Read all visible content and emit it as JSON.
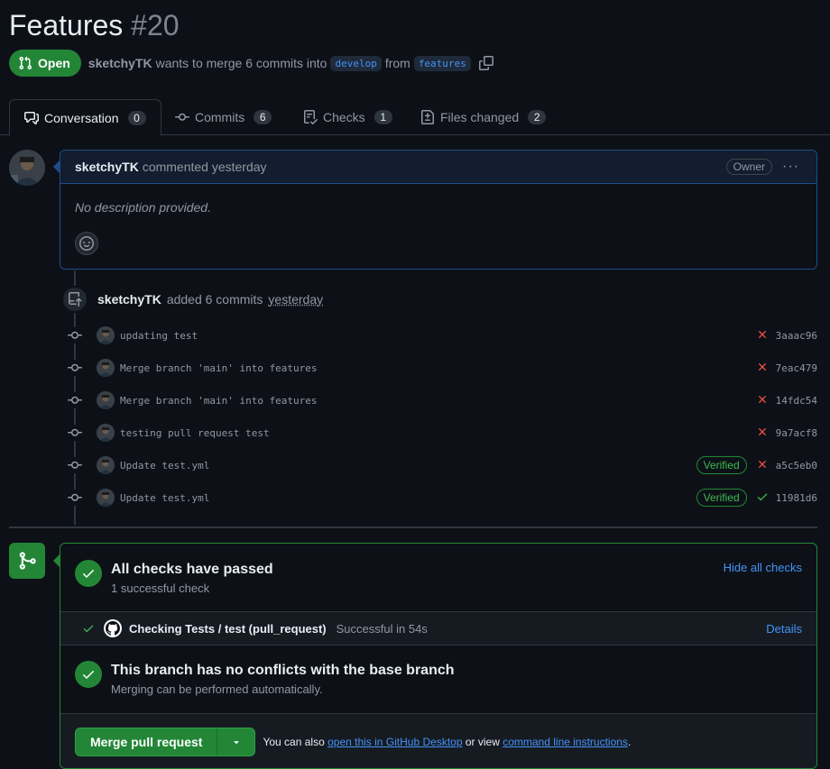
{
  "pr": {
    "title": "Features",
    "number": "#20",
    "state": "Open",
    "author": "sketchyTK",
    "merge_text": "wants to merge 6 commits into",
    "base_branch": "develop",
    "from_text": "from",
    "head_branch": "features"
  },
  "tabs": [
    {
      "label": "Conversation",
      "count": "0"
    },
    {
      "label": "Commits",
      "count": "6"
    },
    {
      "label": "Checks",
      "count": "1"
    },
    {
      "label": "Files changed",
      "count": "2"
    }
  ],
  "comment": {
    "author": "sketchyTK",
    "action": "commented yesterday",
    "role": "Owner",
    "menu": "···",
    "body": "No description provided."
  },
  "commits_event": {
    "author": "sketchyTK",
    "action": "added 6 commits",
    "time": "yesterday"
  },
  "commits": [
    {
      "message": "updating test",
      "sha": "3aaac96",
      "status": "fail",
      "verified": ""
    },
    {
      "message": "Merge branch 'main' into features",
      "sha": "7eac479",
      "status": "fail",
      "verified": ""
    },
    {
      "message": "Merge branch 'main' into features",
      "sha": "14fdc54",
      "status": "fail",
      "verified": ""
    },
    {
      "message": "testing pull request test",
      "sha": "9a7acf8",
      "status": "fail",
      "verified": ""
    },
    {
      "message": "Update test.yml",
      "sha": "a5c5eb0",
      "status": "fail",
      "verified": "Verified"
    },
    {
      "message": "Update test.yml",
      "sha": "11981d6",
      "status": "pass",
      "verified": "Verified"
    }
  ],
  "merge": {
    "checks_title": "All checks have passed",
    "checks_sub": "1 successful check",
    "hide_checks": "Hide all checks",
    "check_name": "Checking Tests / test (pull_request)",
    "check_status": "Successful in 54s",
    "details": "Details",
    "conflict_title": "This branch has no conflicts with the base branch",
    "conflict_sub": "Merging can be performed automatically.",
    "merge_button": "Merge pull request",
    "footer_prefix": "You can also",
    "footer_link1": "open this in GitHub Desktop",
    "footer_mid": "or view",
    "footer_link2": "command line instructions",
    "footer_end": "."
  },
  "colors": {
    "accent": "#4493f8",
    "success": "#238636",
    "danger": "#f85149",
    "background": "#0d1117"
  }
}
